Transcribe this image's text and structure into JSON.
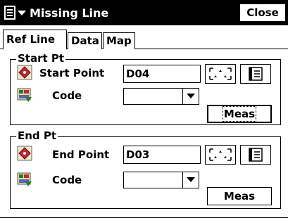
{
  "window": {
    "title": "Missing Line",
    "close_label": "Close",
    "menu_icon": "menu-dropdown-icon"
  },
  "tabs": [
    {
      "label": "Ref Line",
      "active": true
    },
    {
      "label": "Data",
      "active": false
    },
    {
      "label": "Map",
      "active": false
    }
  ],
  "start_pt": {
    "group_title": "Start Pt",
    "point_label": "Start Point",
    "point_value": "D04",
    "code_label": "Code",
    "code_value": "",
    "meas_label": "Meas",
    "point_icon": "point-icon",
    "code_icon": "code-icon",
    "map_pick_icon": "map-pick-icon",
    "list_icon": "list-icon"
  },
  "end_pt": {
    "group_title": "End Pt",
    "point_label": "End Point",
    "point_value": "D03",
    "code_label": "Code",
    "code_value": "",
    "meas_label": "Meas",
    "point_icon": "point-icon",
    "code_icon": "code-icon",
    "map_pick_icon": "map-pick-icon",
    "list_icon": "list-icon"
  }
}
